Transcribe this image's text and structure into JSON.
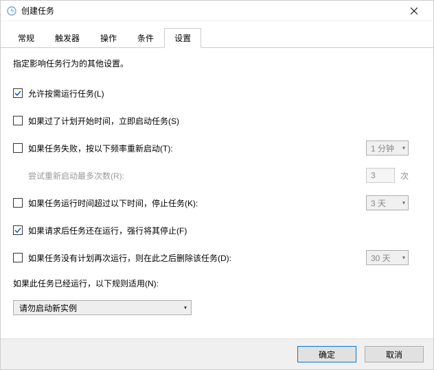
{
  "window": {
    "title": "创建任务"
  },
  "tabs": [
    {
      "label": "常规"
    },
    {
      "label": "触发器"
    },
    {
      "label": "操作"
    },
    {
      "label": "条件"
    },
    {
      "label": "设置"
    }
  ],
  "content": {
    "description": "指定影响任务行为的其他设置。",
    "allow_demand_start": {
      "checked": true,
      "label": "允许按需运行任务(L)"
    },
    "run_asap_missed": {
      "checked": false,
      "label": "如果过了计划开始时间，立即启动任务(S)"
    },
    "restart_on_fail": {
      "checked": false,
      "label": "如果任务失败，按以下频率重新启动(T):",
      "interval": "1 分钟"
    },
    "restart_attempts": {
      "label": "尝试重新启动最多次数(R):",
      "value": "3",
      "suffix": "次"
    },
    "stop_if_long": {
      "checked": false,
      "label": "如果任务运行时间超过以下时间，停止任务(K):",
      "duration": "3 天"
    },
    "force_stop": {
      "checked": true,
      "label": "如果请求后任务还在运行，强行将其停止(F)"
    },
    "delete_after": {
      "checked": false,
      "label": "如果任务没有计划再次运行，则在此之后删除该任务(D):",
      "duration": "30 天"
    },
    "already_running_label": "如果此任务已经运行，以下规则适用(N):",
    "already_running_rule": "请勿启动新实例"
  },
  "footer": {
    "ok": "确定",
    "cancel": "取消"
  }
}
